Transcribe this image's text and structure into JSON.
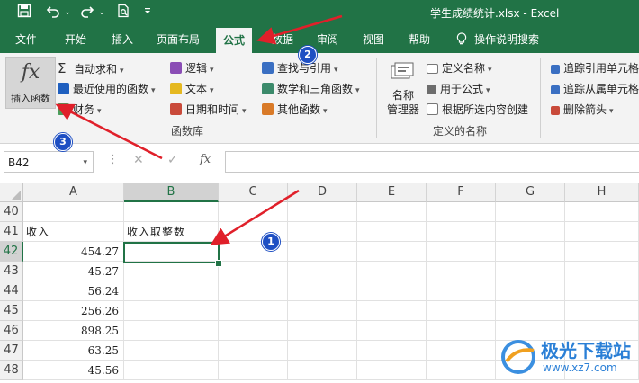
{
  "title_bar": {
    "file_title": "学生成绩统计.xlsx  -  Excel",
    "qat_icons": [
      "save-icon",
      "undo-icon",
      "redo-icon",
      "print-preview-icon",
      "customize-icon"
    ]
  },
  "tabs": [
    "文件",
    "开始",
    "插入",
    "页面布局",
    "公式",
    "数据",
    "审阅",
    "视图",
    "帮助",
    "操作说明搜索"
  ],
  "active_tab": "公式",
  "ribbon": {
    "insert_function": {
      "symbol": "fx",
      "label": "插入函数"
    },
    "function_library": {
      "items": [
        "自动求和",
        "最近使用的函数",
        "财务",
        "逻辑",
        "文本",
        "日期和时间",
        "查找与引用",
        "数学和三角函数",
        "其他函数"
      ],
      "group_label": "函数库"
    },
    "defined_names": {
      "name_manager": [
        "名称",
        "管理器"
      ],
      "items": [
        "定义名称",
        "用于公式",
        "根据所选内容创建"
      ],
      "group_label": "定义的名称"
    },
    "auditing": {
      "items": [
        "追踪引用单元格",
        "追踪从属单元格",
        "删除箭头"
      ]
    }
  },
  "formula_bar": {
    "name_box": "B42",
    "cancel_symbol": "✕",
    "enter_symbol": "✓",
    "fx_symbol": "fx",
    "value": ""
  },
  "sheet": {
    "columns": [
      "A",
      "B",
      "C",
      "D",
      "E",
      "F",
      "G",
      "H"
    ],
    "rows": [
      {
        "num": "40",
        "a": "",
        "b": ""
      },
      {
        "num": "41",
        "a": "收入",
        "b": "收入取整数"
      },
      {
        "num": "42",
        "a": "454.27",
        "b": ""
      },
      {
        "num": "43",
        "a": "45.27",
        "b": ""
      },
      {
        "num": "44",
        "a": "56.24",
        "b": ""
      },
      {
        "num": "45",
        "a": "256.26",
        "b": ""
      },
      {
        "num": "46",
        "a": "898.25",
        "b": ""
      },
      {
        "num": "47",
        "a": "63.25",
        "b": ""
      },
      {
        "num": "48",
        "a": "45.56",
        "b": ""
      }
    ],
    "selected_cell": "B42"
  },
  "annotations": {
    "badges": [
      "1",
      "2",
      "3"
    ],
    "arrow_color": "#e0202a",
    "badge_color": "#1e4fc3"
  },
  "watermark": {
    "brand": "极光下载站",
    "url": "www.xz7.com"
  },
  "colors": {
    "excel_green": "#217346",
    "ribbon_bg": "#f3f3f3"
  }
}
